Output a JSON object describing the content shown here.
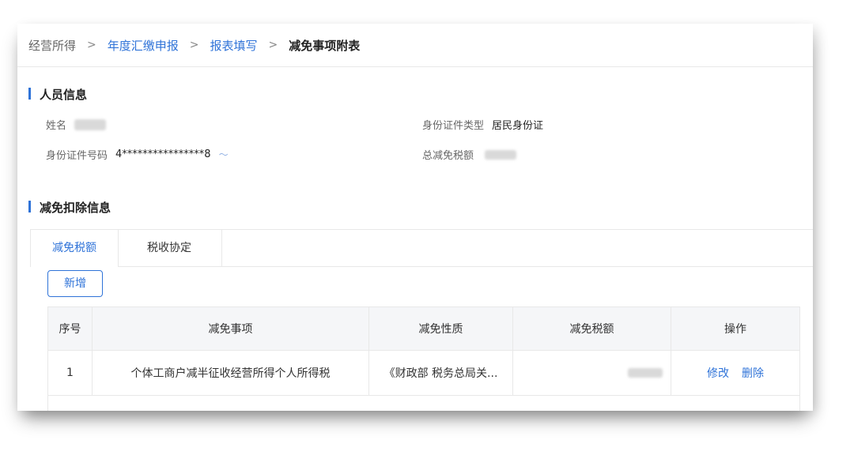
{
  "breadcrumb": {
    "items": [
      "经营所得",
      "年度汇缴申报",
      "报表填写",
      "减免事项附表"
    ],
    "separator": ">"
  },
  "personal_info": {
    "section_title": "人员信息",
    "name_label": "姓名",
    "id_type_label": "身份证件类型",
    "id_type_value": "居民身份证",
    "id_number_label": "身份证件号码",
    "id_number_value": "4****************8",
    "total_reduction_label": "总减免税额"
  },
  "deduction_info": {
    "section_title": "减免扣除信息",
    "tabs": [
      {
        "label": "减免税额",
        "active": true
      },
      {
        "label": "税收协定",
        "active": false
      }
    ],
    "add_button": "新增",
    "table": {
      "columns": [
        "序号",
        "减免事项",
        "减免性质",
        "减免税额",
        "操作"
      ],
      "rows": [
        {
          "index": "1",
          "item": "个体工商户减半征收经营所得个人所得税",
          "nature": "《财政部 税务总局关...",
          "edit": "修改",
          "delete": "删除"
        }
      ]
    }
  },
  "colors": {
    "accent": "#2f73d8",
    "border": "#e8e8e8",
    "header_bg": "#f5f6f8"
  },
  "icons": {
    "id_toggle": "eye-icon"
  }
}
